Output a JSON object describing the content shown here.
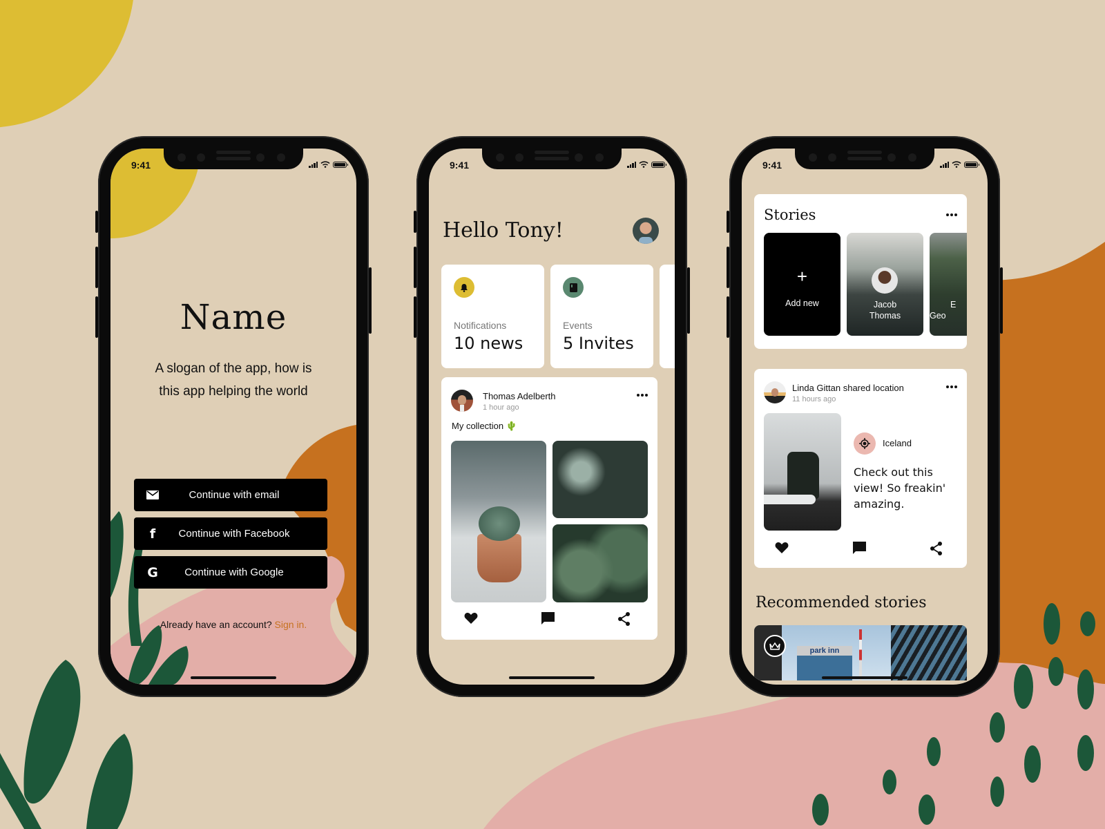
{
  "colors": {
    "background": "#dfcfb6",
    "yellow": "#ddbd33",
    "orange": "#c6711f",
    "pink": "#e3aea8",
    "green": "#1c5739",
    "link": "#c6711f",
    "badge_green": "#5a8870",
    "location_pink": "#ebb8b0"
  },
  "status_bar": {
    "time": "9:41"
  },
  "welcome_screen": {
    "app_name": "Name",
    "slogan_line1": "A slogan of the app, how is",
    "slogan_line2": "this app helping the world",
    "buttons": [
      {
        "label": "Continue with email",
        "icon": "mail-icon"
      },
      {
        "label": "Continue with Facebook",
        "icon": "facebook-icon"
      },
      {
        "label": "Continue with Google",
        "icon": "google-icon"
      }
    ],
    "signin_prompt": "Already have an account?",
    "signin_link": "Sign in."
  },
  "home_screen": {
    "greeting": "Hello Tony!",
    "stat_cards": [
      {
        "caption": "Notifications",
        "value": "10 news",
        "icon": "bell-icon"
      },
      {
        "caption": "Events",
        "value": "5 Invites",
        "icon": "book-icon"
      }
    ],
    "post": {
      "author": "Thomas Adelberth",
      "time_ago": "1 hour ago",
      "caption": "My collection 🌵"
    }
  },
  "feed_screen": {
    "stories_title": "Stories",
    "stories": [
      {
        "name_line1": "",
        "name_line2": "Add new",
        "type": "add"
      },
      {
        "name_line1": "Jacob",
        "name_line2": "Thomas"
      },
      {
        "name_line1": "E",
        "name_line2": "Geo"
      }
    ],
    "add_symbol": "+",
    "location_post": {
      "author_line": "Linda Gittan shared location",
      "time_ago": "11 hours ago",
      "location": "Iceland",
      "text": "Check out this view! So freakin' amazing."
    },
    "recommended_title": "Recommended stories",
    "recommended_sign": "park inn"
  }
}
